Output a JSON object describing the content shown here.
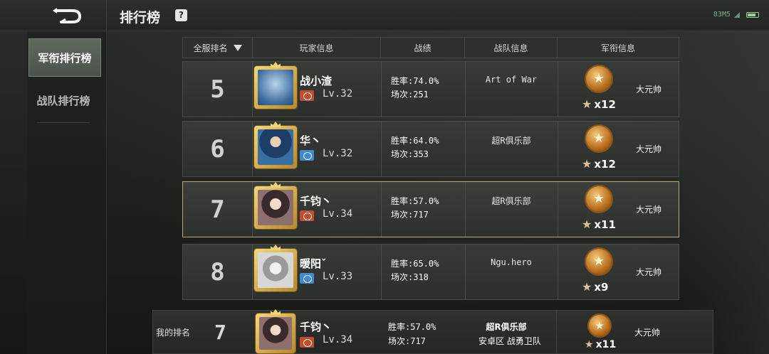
{
  "header": {
    "title": "排行榜",
    "help": "?",
    "status": "83M5"
  },
  "sidebar": {
    "items": [
      {
        "label": "军衔排行榜"
      },
      {
        "label": "战队排行榜"
      }
    ]
  },
  "table": {
    "headers": [
      "全服排名",
      "玩家信息",
      "战绩",
      "战队信息",
      "军衔信息"
    ],
    "rows": [
      {
        "rank": "5",
        "name": "战小渣",
        "camp": "red",
        "level": "Lv.32",
        "win_rate": "胜率:74.0%",
        "games": "场次:251",
        "team": "Art of War",
        "stars": "x12",
        "title": "大元帅"
      },
      {
        "rank": "6",
        "name": "华丶",
        "camp": "blue",
        "level": "Lv.32",
        "win_rate": "胜率:64.0%",
        "games": "场次:353",
        "team": "超R俱乐部",
        "stars": "x12",
        "title": "大元帅"
      },
      {
        "rank": "7",
        "name": "千钧丶",
        "camp": "red",
        "level": "Lv.34",
        "win_rate": "胜率:57.0%",
        "games": "场次:717",
        "team": "超R俱乐部",
        "stars": "x11",
        "title": "大元帅"
      },
      {
        "rank": "8",
        "name": "暖阳ˇ",
        "camp": "blue",
        "level": "Lv.33",
        "win_rate": "胜率:65.0%",
        "games": "场次:318",
        "team": "Ngu.hero",
        "stars": "x9",
        "title": "大元帅"
      }
    ]
  },
  "my_rank": {
    "label": "我的排名",
    "rank": "7",
    "name": "千钧丶",
    "level": "Lv.34",
    "win_rate": "胜率:57.0%",
    "games": "场次:717",
    "team": "超R俱乐部",
    "region": "安卓区 战勇卫队",
    "stars": "x11",
    "title": "大元帅"
  },
  "icons": {
    "back": "back-arrow-icon",
    "help": "question-icon",
    "medal": "rank-medal-icon",
    "star": "star-icon",
    "camp_red": "red-camp-icon",
    "camp_blue": "blue-camp-icon"
  },
  "colors": {
    "highlight_border": "#b8a878",
    "camp_red": "#c04d2c",
    "camp_blue": "#3d8ad0",
    "medal": "#b76e1e"
  }
}
